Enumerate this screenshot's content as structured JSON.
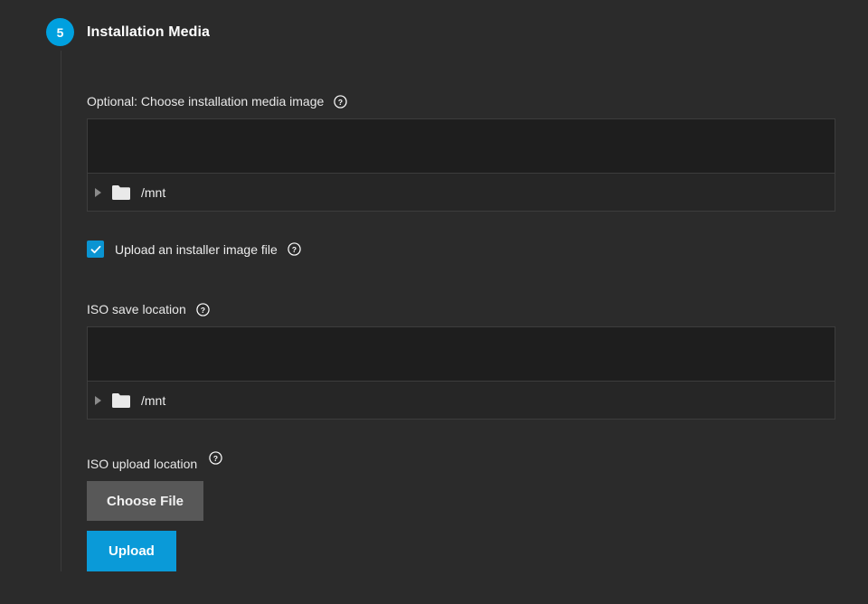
{
  "step": {
    "number": "5",
    "title": "Installation Media"
  },
  "fields": {
    "installation_media": {
      "label": "Optional: Choose installation media image",
      "help_icon": "help-circle-icon",
      "tree": {
        "input_value": "",
        "rows": [
          {
            "caret": "caret-right-icon",
            "icon": "folder-icon",
            "label": "/mnt"
          }
        ]
      }
    },
    "upload_installer": {
      "label": "Upload an installer image file",
      "checked": true,
      "help_icon": "help-circle-icon"
    },
    "iso_save_location": {
      "label": "ISO save location",
      "help_icon": "help-circle-icon",
      "tree": {
        "input_value": "",
        "rows": [
          {
            "caret": "caret-right-icon",
            "icon": "folder-icon",
            "label": "/mnt"
          }
        ]
      }
    },
    "iso_upload_location": {
      "label": "ISO upload location",
      "help_icon": "help-circle-icon",
      "choose_file_label": "Choose File",
      "upload_label": "Upload"
    }
  },
  "colors": {
    "background": "#2b2b2b",
    "accent_blue": "#0a9ad8",
    "badge_blue": "#00a0df",
    "button_gray": "#585858",
    "panel_dark": "#1e1e1e",
    "panel_list": "#262626",
    "border": "#3d3d3d"
  }
}
